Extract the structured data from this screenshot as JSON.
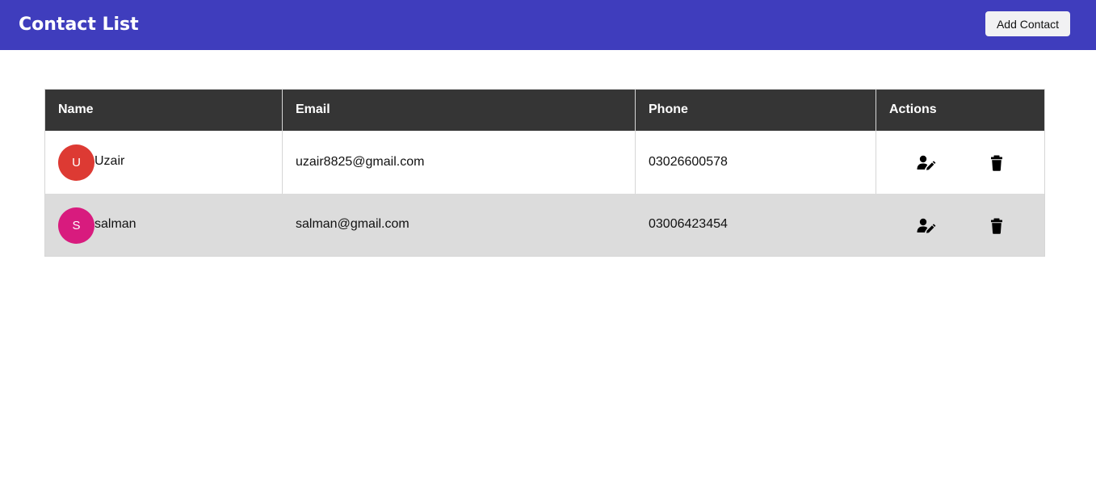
{
  "header": {
    "title": "Contact List",
    "add_button_label": "Add Contact",
    "background_color": "#3f3dbd"
  },
  "table": {
    "columns": [
      "Name",
      "Email",
      "Phone",
      "Actions"
    ],
    "rows": [
      {
        "initial": "U",
        "name": "Uzair",
        "email": "uzair8825@gmail.com",
        "phone": "03026600578",
        "avatar_color": "#dd3a33",
        "edit_icon": "user-edit-icon",
        "delete_icon": "trash-icon"
      },
      {
        "initial": "S",
        "name": "salman",
        "email": "salman@gmail.com",
        "phone": "03006423454",
        "avatar_color": "#d81b7e",
        "edit_icon": "user-edit-icon",
        "delete_icon": "trash-icon"
      }
    ]
  }
}
